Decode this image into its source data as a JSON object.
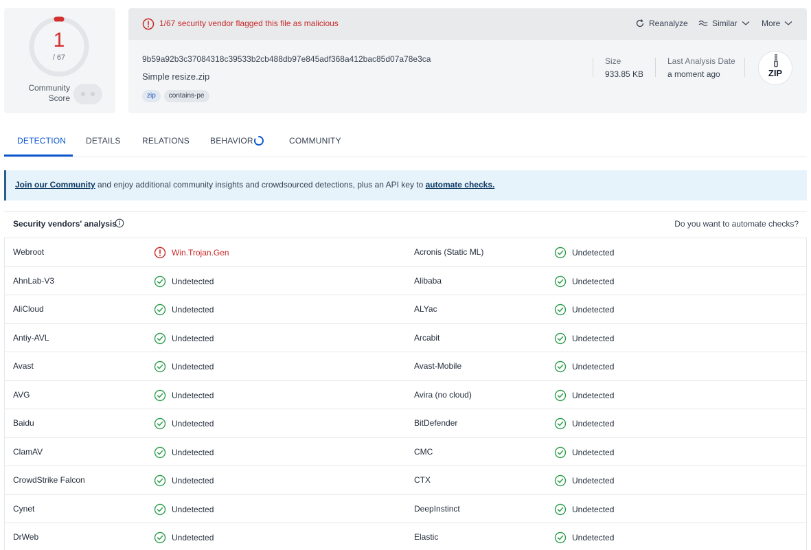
{
  "score": {
    "detections": "1",
    "total": "/ 67",
    "community_label_1": "Community",
    "community_label_2": "Score"
  },
  "header": {
    "alert": "1/67 security vendor flagged this file as malicious",
    "actions": {
      "reanalyze": "Reanalyze",
      "similar": "Similar",
      "more": "More"
    },
    "hash": "9b59a92b3c37084318c39533b2cb488db97e845adf368a412bac85d07a78e3ca",
    "filename": "Simple resize.zip",
    "tags": [
      "zip",
      "contains-pe"
    ],
    "size_label": "Size",
    "size_value": "933.85 KB",
    "date_label": "Last Analysis Date",
    "date_value": "a moment ago",
    "file_type": "ZIP"
  },
  "tabs": [
    "DETECTION",
    "DETAILS",
    "RELATIONS",
    "BEHAVIOR",
    "COMMUNITY"
  ],
  "banner": {
    "link1": "Join our Community",
    "middle": " and enjoy additional community insights and crowdsourced detections, plus an API key to ",
    "link2": "automate checks."
  },
  "vendors_section": {
    "title": "Security vendors' analysis",
    "right_text": "Do you want to automate checks?"
  },
  "colors": {
    "malicious": "#c62828",
    "clean": "#2e9e4e",
    "accent": "#0b57d0"
  },
  "vendors": [
    {
      "left": "Webroot",
      "left_result": "Win.Trojan.Gen",
      "left_status": "malicious",
      "right": "Acronis (Static ML)",
      "right_result": "Undetected",
      "right_status": "clean"
    },
    {
      "left": "AhnLab-V3",
      "left_result": "Undetected",
      "left_status": "clean",
      "right": "Alibaba",
      "right_result": "Undetected",
      "right_status": "clean"
    },
    {
      "left": "AliCloud",
      "left_result": "Undetected",
      "left_status": "clean",
      "right": "ALYac",
      "right_result": "Undetected",
      "right_status": "clean"
    },
    {
      "left": "Antiy-AVL",
      "left_result": "Undetected",
      "left_status": "clean",
      "right": "Arcabit",
      "right_result": "Undetected",
      "right_status": "clean"
    },
    {
      "left": "Avast",
      "left_result": "Undetected",
      "left_status": "clean",
      "right": "Avast-Mobile",
      "right_result": "Undetected",
      "right_status": "clean"
    },
    {
      "left": "AVG",
      "left_result": "Undetected",
      "left_status": "clean",
      "right": "Avira (no cloud)",
      "right_result": "Undetected",
      "right_status": "clean"
    },
    {
      "left": "Baidu",
      "left_result": "Undetected",
      "left_status": "clean",
      "right": "BitDefender",
      "right_result": "Undetected",
      "right_status": "clean"
    },
    {
      "left": "ClamAV",
      "left_result": "Undetected",
      "left_status": "clean",
      "right": "CMC",
      "right_result": "Undetected",
      "right_status": "clean"
    },
    {
      "left": "CrowdStrike Falcon",
      "left_result": "Undetected",
      "left_status": "clean",
      "right": "CTX",
      "right_result": "Undetected",
      "right_status": "clean"
    },
    {
      "left": "Cynet",
      "left_result": "Undetected",
      "left_status": "clean",
      "right": "DeepInstinct",
      "right_result": "Undetected",
      "right_status": "clean"
    },
    {
      "left": "DrWeb",
      "left_result": "Undetected",
      "left_status": "clean",
      "right": "Elastic",
      "right_result": "Undetected",
      "right_status": "clean"
    }
  ]
}
